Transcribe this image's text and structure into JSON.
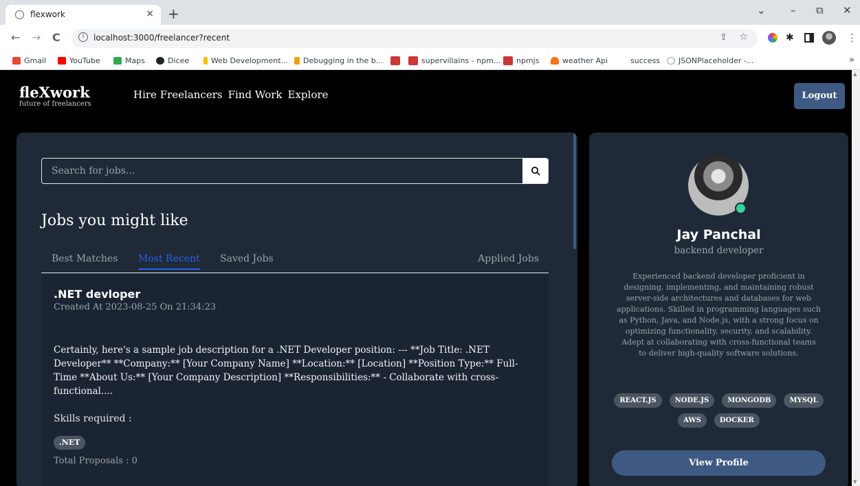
{
  "browser": {
    "tab_title": "flexwork",
    "tab_close": "×",
    "new_tab": "+",
    "url": "localhost:3000/freelancer?recent",
    "window_controls": {
      "minimize": "⌄",
      "min2": "–",
      "restore": "⧉",
      "close": "✕"
    },
    "bookmarks": [
      {
        "label": "Gmail",
        "color": "#ea4335"
      },
      {
        "label": "YouTube",
        "color": "#ff0000"
      },
      {
        "label": "Maps",
        "color": "#34a853"
      },
      {
        "label": "Dicee",
        "color": "#202124"
      },
      {
        "label": "Web Development...",
        "color": "#fbbc05"
      },
      {
        "label": "Debugging in the b...",
        "color": "#f59e0b"
      },
      {
        "label": "",
        "color": "#cb3837"
      },
      {
        "label": "supervillains - npm...",
        "color": "#cb3837"
      },
      {
        "label": "npmjs",
        "color": "#cb3837"
      },
      {
        "label": "weather Api",
        "color": "#f97316"
      },
      {
        "label": "success",
        "color": ""
      },
      {
        "label": "JSONPlaceholder -...",
        "color": "#9ca3af"
      }
    ],
    "bookmarks_more": "»"
  },
  "header": {
    "logo": "fleXwork",
    "tagline": "future of freelancers",
    "nav": [
      "Hire Freelancers",
      "Find Work",
      "Explore"
    ],
    "logout_label": "Logout"
  },
  "main": {
    "search_placeholder": "Search for jobs...",
    "heading": "Jobs you might like",
    "tabs": [
      "Best Matches",
      "Most Recent",
      "Saved Jobs",
      "Applied Jobs"
    ],
    "active_tab": "Most Recent",
    "job": {
      "title": ".NET devloper",
      "created": "Created At 2023-08-25 On 21:34:23",
      "description": "Certainly, here's a sample job description for a .NET Developer position: --- **Job Title: .NET Developer** **Company:** [Your Company Name] **Location:** [Location] **Position Type:** Full-Time **About Us:** [Your Company Description] **Responsibilities:** - Collaborate with cross-functional....",
      "skills_label": "Skills required :",
      "skills": [
        ".NET"
      ],
      "proposals": "Total Proposals : 0"
    }
  },
  "profile": {
    "name": "Jay Panchal",
    "role": "backend developer",
    "bio": "Experienced backend developer proficient in designing, implementing, and maintaining robust server-side architectures and databases for web applications. Skilled in programming languages such as Python, Java, and Node.js, with a strong focus on optimizing functionality, security, and scalability. Adept at collaborating with cross-functional teams to deliver high-quality software solutions.",
    "skills": [
      "REACT.JS",
      "NODE.JS",
      "MONGODB",
      "MYSQL",
      "AWS",
      "DOCKER"
    ],
    "view_profile_label": "View Profile",
    "status_color": "#34d399"
  },
  "colors": {
    "accent": "#3e5a82",
    "active_tab": "#2563eb",
    "panel": "#1f2937"
  }
}
